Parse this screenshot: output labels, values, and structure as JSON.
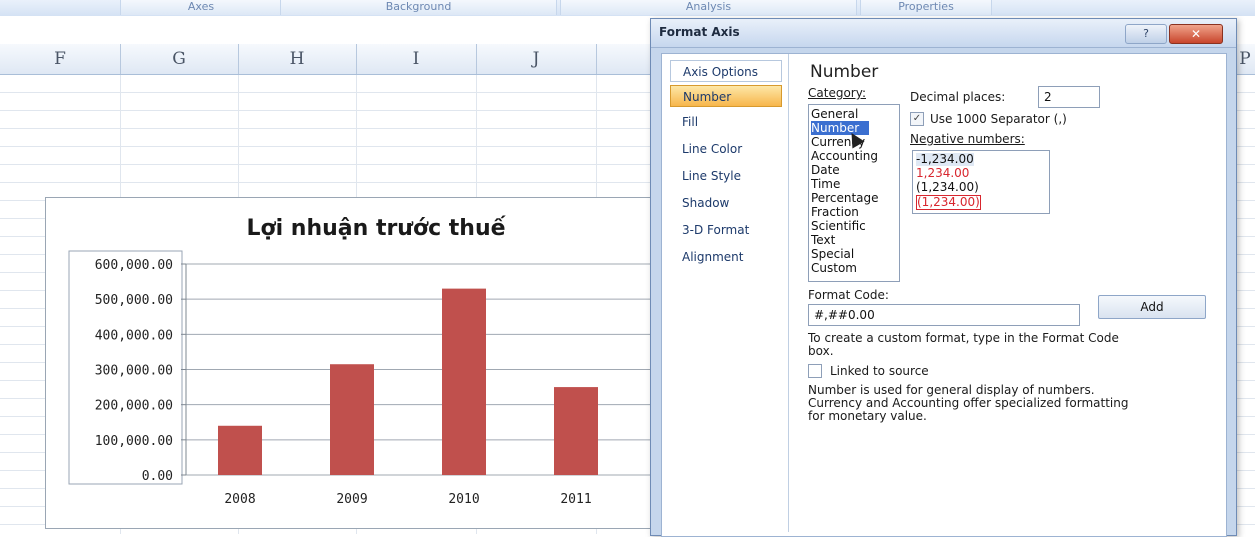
{
  "ribbon": {
    "tabs": [
      "Axes",
      "Background",
      "Analysis",
      "Properties"
    ]
  },
  "sheet": {
    "columns": [
      "F",
      "G",
      "H",
      "I",
      "J",
      "P"
    ]
  },
  "chart_data": {
    "type": "bar",
    "title": "Lợi nhuận trước thuế",
    "categories": [
      "2008",
      "2009",
      "2010",
      "2011"
    ],
    "values": [
      140000,
      315000,
      530000,
      250000
    ],
    "yticks": [
      "600,000.00",
      "500,000.00",
      "400,000.00",
      "300,000.00",
      "200,000.00",
      "100,000.00",
      "0.00"
    ],
    "ylim": [
      0,
      600000
    ],
    "grid": true,
    "bar_color": "#c0504d"
  },
  "dialog": {
    "title": "Format Axis",
    "help_label": "?",
    "close_label": "✕",
    "nav": [
      "Axis Options",
      "Number",
      "Fill",
      "Line Color",
      "Line Style",
      "Shadow",
      "3-D Format",
      "Alignment"
    ],
    "selected_nav": "Number",
    "section_title": "Number",
    "category_label": "Category:",
    "categories": [
      "General",
      "Number",
      "Currency",
      "Accounting",
      "Date",
      "Time",
      "Percentage",
      "Fraction",
      "Scientific",
      "Text",
      "Special",
      "Custom"
    ],
    "selected_category": "Number",
    "decimal_places_label": "Decimal places:",
    "decimal_places_value": "2",
    "separator_label": "Use 1000 Separator (,)",
    "separator_checked": true,
    "negative_label": "Negative numbers:",
    "negative_options": [
      {
        "text": "-1,234.00",
        "color": "#111111"
      },
      {
        "text": "1,234.00",
        "color": "#d8262e"
      },
      {
        "text": "(1,234.00)",
        "color": "#111111"
      },
      {
        "text": "(1,234.00)",
        "color": "#d8262e"
      }
    ],
    "format_code_label": "Format Code:",
    "format_code_value": "#,##0.00",
    "add_label": "Add",
    "custom_hint_1": "To create a custom format, type in the Format Code",
    "custom_hint_2": "box.",
    "linked_label": "Linked to source",
    "linked_checked": false,
    "desc_1": "Number is used for general display of numbers.",
    "desc_2": "Currency and Accounting offer specialized formatting",
    "desc_3": "for monetary value."
  }
}
